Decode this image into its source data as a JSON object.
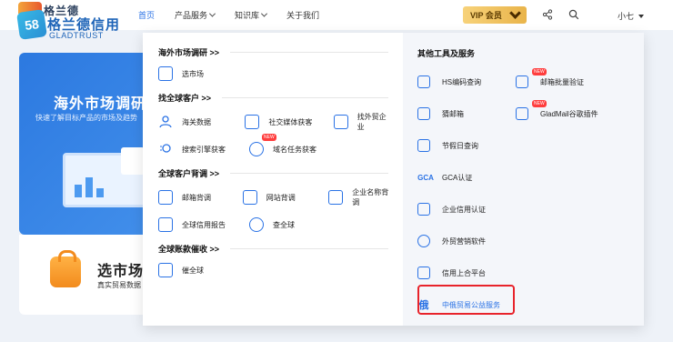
{
  "logo": {
    "cn_small": "格兰德",
    "cn": "格兰德信用",
    "en": "GLADTRUST",
    "badge": "58"
  },
  "nav": {
    "items": [
      {
        "label": "首页",
        "active": true,
        "dropdown": false
      },
      {
        "label": "产品服务",
        "active": false,
        "dropdown": true
      },
      {
        "label": "知识库",
        "active": false,
        "dropdown": true
      },
      {
        "label": "关于我们",
        "active": false,
        "dropdown": false
      }
    ],
    "vip_label": "VIP 会员",
    "user_name": "小七"
  },
  "hero": {
    "title": "海外市场调研",
    "subtitle": "快速了解目标产品的市场及趋势"
  },
  "lower_card": {
    "title": "选市场",
    "subtitle": "真实贸易数据"
  },
  "dropdown": {
    "sections": [
      {
        "title": "海外市场调研 >>",
        "items": [
          {
            "label": "选市场",
            "icon": "monitor-icon"
          }
        ]
      },
      {
        "title": "找全球客户 >>",
        "items": [
          {
            "label": "海关数据",
            "icon": "person-icon"
          },
          {
            "label": "社交媒体获客",
            "icon": "building-icon"
          },
          {
            "label": "找外贸企业",
            "icon": "car-icon"
          },
          {
            "label": "搜索引擎获客",
            "icon": "search-engine-icon"
          },
          {
            "label": "域名任务获客",
            "icon": "www-icon",
            "new": "NEW"
          }
        ]
      },
      {
        "title": "全球客户背调 >>",
        "items": [
          {
            "label": "邮箱背调",
            "icon": "mail-icon"
          },
          {
            "label": "网站背调",
            "icon": "website-icon"
          },
          {
            "label": "企业名称背调",
            "icon": "company-icon"
          },
          {
            "label": "全球信用报告",
            "icon": "report-icon"
          },
          {
            "label": "查全球",
            "icon": "globe-icon"
          }
        ]
      },
      {
        "title": "全球账款催收 >>",
        "items": [
          {
            "label": "催全球",
            "icon": "collect-icon"
          }
        ]
      }
    ],
    "right": {
      "title": "其他工具及服务",
      "items": [
        {
          "label": "HS编码查询",
          "icon": "code-icon"
        },
        {
          "label": "邮箱批量验证",
          "icon": "mail-verify-icon",
          "new": "NEW"
        },
        {
          "label": "猜邮箱",
          "icon": "guess-mail-icon"
        },
        {
          "label": "GladMail谷歌插件",
          "icon": "puzzle-icon",
          "new": "NEW"
        },
        {
          "label": "节假日查询",
          "icon": "calendar-icon"
        },
        {
          "label": "",
          "icon": ""
        },
        {
          "label": "GCA认证",
          "icon": "gca-icon",
          "icon_text": "GCA"
        },
        {
          "label": "",
          "icon": ""
        },
        {
          "label": "企业信用认证",
          "icon": "credit-icon"
        },
        {
          "label": "",
          "icon": ""
        },
        {
          "label": "外贸营销软件",
          "icon": "marketing-icon"
        },
        {
          "label": "",
          "icon": ""
        },
        {
          "label": "信用上合平台",
          "icon": "sco-icon"
        },
        {
          "label": "",
          "icon": ""
        },
        {
          "label": "中俄贸易公益服务",
          "icon": "russia-icon",
          "icon_text": "俄",
          "highlighted": true
        }
      ]
    }
  },
  "colors": {
    "accent": "#2a72e5",
    "highlight_border": "#e8232b",
    "vip_gold": "#f0c45e"
  }
}
